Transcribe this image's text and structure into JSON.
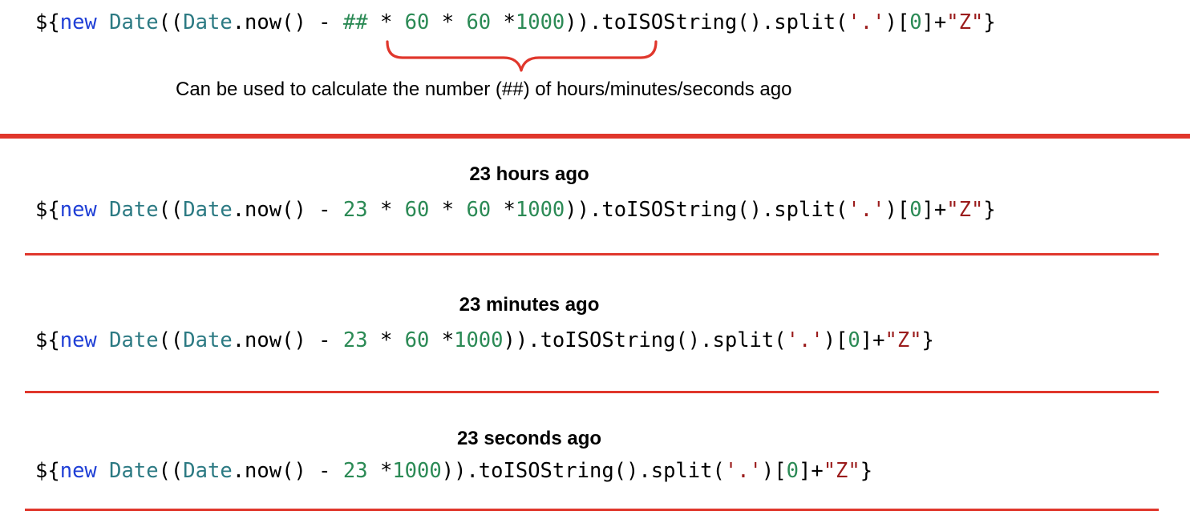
{
  "template_block": {
    "code_tokens": [
      {
        "text": "${",
        "kind": "plain"
      },
      {
        "text": "new",
        "kind": "kw"
      },
      {
        "text": " ",
        "kind": "plain"
      },
      {
        "text": "Date",
        "kind": "type"
      },
      {
        "text": "((",
        "kind": "plain"
      },
      {
        "text": "Date",
        "kind": "type"
      },
      {
        "text": ".now() - ",
        "kind": "plain"
      },
      {
        "text": "##",
        "kind": "num"
      },
      {
        "text": " * ",
        "kind": "plain"
      },
      {
        "text": "60",
        "kind": "num"
      },
      {
        "text": " * ",
        "kind": "plain"
      },
      {
        "text": "60",
        "kind": "num"
      },
      {
        "text": " *",
        "kind": "plain"
      },
      {
        "text": "1000",
        "kind": "num"
      },
      {
        "text": ")).toISOString().split(",
        "kind": "plain"
      },
      {
        "text": "'.'",
        "kind": "str"
      },
      {
        "text": ")[",
        "kind": "plain"
      },
      {
        "text": "0",
        "kind": "num"
      },
      {
        "text": "]+",
        "kind": "plain"
      },
      {
        "text": "\"Z\"",
        "kind": "str"
      },
      {
        "text": "}",
        "kind": "plain"
      }
    ],
    "caption": "Can be used to calculate the number (##) of hours/minutes/seconds ago"
  },
  "examples": [
    {
      "caption": "23 hours ago",
      "code_tokens": [
        {
          "text": "${",
          "kind": "plain"
        },
        {
          "text": "new",
          "kind": "kw"
        },
        {
          "text": " ",
          "kind": "plain"
        },
        {
          "text": "Date",
          "kind": "type"
        },
        {
          "text": "((",
          "kind": "plain"
        },
        {
          "text": "Date",
          "kind": "type"
        },
        {
          "text": ".now() - ",
          "kind": "plain"
        },
        {
          "text": "23",
          "kind": "num"
        },
        {
          "text": " * ",
          "kind": "plain"
        },
        {
          "text": "60",
          "kind": "num"
        },
        {
          "text": " * ",
          "kind": "plain"
        },
        {
          "text": "60",
          "kind": "num"
        },
        {
          "text": " *",
          "kind": "plain"
        },
        {
          "text": "1000",
          "kind": "num"
        },
        {
          "text": ")).toISOString().split(",
          "kind": "plain"
        },
        {
          "text": "'.'",
          "kind": "str"
        },
        {
          "text": ")[",
          "kind": "plain"
        },
        {
          "text": "0",
          "kind": "num"
        },
        {
          "text": "]+",
          "kind": "plain"
        },
        {
          "text": "\"Z\"",
          "kind": "str"
        },
        {
          "text": "}",
          "kind": "plain"
        }
      ]
    },
    {
      "caption": "23 minutes ago",
      "code_tokens": [
        {
          "text": "${",
          "kind": "plain"
        },
        {
          "text": "new",
          "kind": "kw"
        },
        {
          "text": " ",
          "kind": "plain"
        },
        {
          "text": "Date",
          "kind": "type"
        },
        {
          "text": "((",
          "kind": "plain"
        },
        {
          "text": "Date",
          "kind": "type"
        },
        {
          "text": ".now() - ",
          "kind": "plain"
        },
        {
          "text": "23",
          "kind": "num"
        },
        {
          "text": " * ",
          "kind": "plain"
        },
        {
          "text": "60",
          "kind": "num"
        },
        {
          "text": " *",
          "kind": "plain"
        },
        {
          "text": "1000",
          "kind": "num"
        },
        {
          "text": ")).toISOString().split(",
          "kind": "plain"
        },
        {
          "text": "'.'",
          "kind": "str"
        },
        {
          "text": ")[",
          "kind": "plain"
        },
        {
          "text": "0",
          "kind": "num"
        },
        {
          "text": "]+",
          "kind": "plain"
        },
        {
          "text": "\"Z\"",
          "kind": "str"
        },
        {
          "text": "}",
          "kind": "plain"
        }
      ]
    },
    {
      "caption": "23 seconds ago",
      "code_tokens": [
        {
          "text": "${",
          "kind": "plain"
        },
        {
          "text": "new",
          "kind": "kw"
        },
        {
          "text": " ",
          "kind": "plain"
        },
        {
          "text": "Date",
          "kind": "type"
        },
        {
          "text": "((",
          "kind": "plain"
        },
        {
          "text": "Date",
          "kind": "type"
        },
        {
          "text": ".now() - ",
          "kind": "plain"
        },
        {
          "text": "23",
          "kind": "num"
        },
        {
          "text": " *",
          "kind": "plain"
        },
        {
          "text": "1000",
          "kind": "num"
        },
        {
          "text": ")).toISOString().split(",
          "kind": "plain"
        },
        {
          "text": "'.'",
          "kind": "str"
        },
        {
          "text": ")[",
          "kind": "plain"
        },
        {
          "text": "0",
          "kind": "num"
        },
        {
          "text": "]+",
          "kind": "plain"
        },
        {
          "text": "\"Z\"",
          "kind": "str"
        },
        {
          "text": "}",
          "kind": "plain"
        }
      ]
    }
  ],
  "colors": {
    "accent_red": "#e0372c",
    "keyword_blue": "#1f3fd6",
    "type_teal": "#2c7a83",
    "number_green": "#2b8a55",
    "string_red": "#9b1c1c"
  }
}
